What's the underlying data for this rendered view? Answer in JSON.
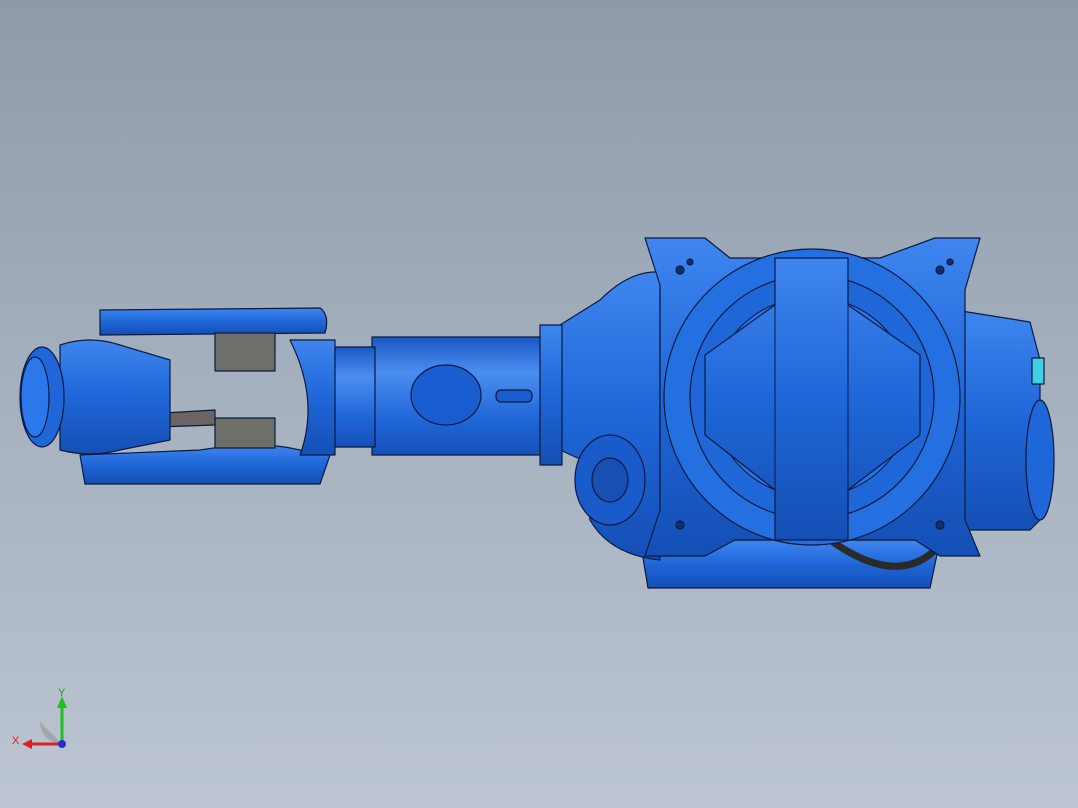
{
  "viewport": {
    "background_top": "#8e9aaa",
    "background_bottom": "#bcc5d1"
  },
  "model": {
    "body_color": "#1f66d8",
    "highlight_color": "#4b8ef0",
    "edge_color": "#0a1a40",
    "gearbox_color": "#6f6f6a"
  },
  "triad": {
    "x_label": "X",
    "y_label": "Y",
    "x_color": "#e02020",
    "y_color": "#20c020",
    "z_color": "#2030d0"
  }
}
